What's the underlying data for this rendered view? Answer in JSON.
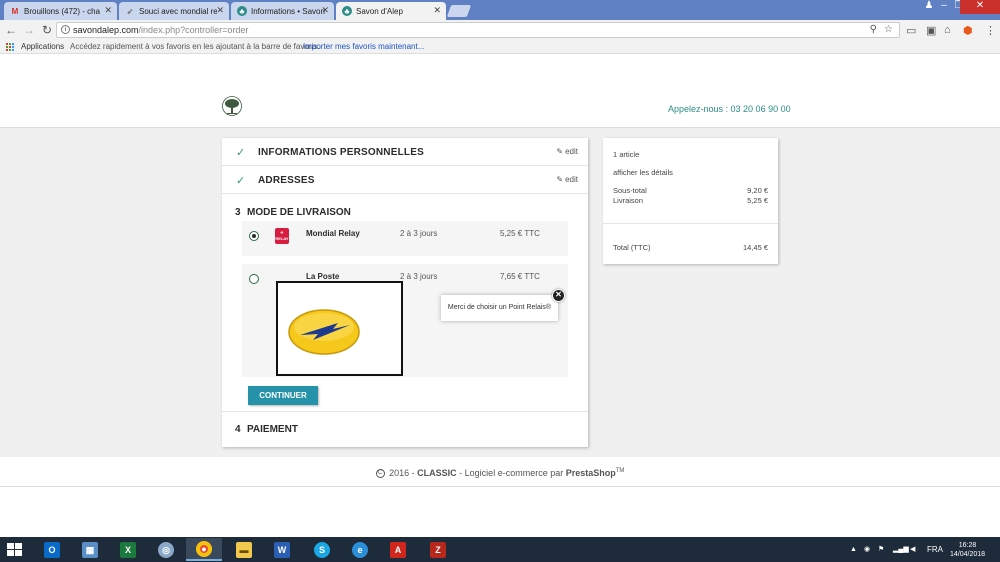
{
  "browser": {
    "tabs": [
      {
        "label": "Brouillons (472) - cha",
        "icon": "gmail-icon",
        "active": false
      },
      {
        "label": "Souci avec mondial re",
        "icon": "bird-icon",
        "active": false
      },
      {
        "label": "Informations • Savon",
        "icon": "tree-icon",
        "active": false
      },
      {
        "label": "Savon d'Alep",
        "icon": "tree-icon",
        "active": true
      }
    ],
    "url_host": "savondalep.com",
    "url_path": "/index.php?controller=order",
    "bookmarks": {
      "apps_label": "Applications",
      "hint": "Accédez rapidement à vos favoris en les ajoutant à la barre de favoris.",
      "import_link": "Importer mes favoris maintenant..."
    }
  },
  "header": {
    "phone": "Appelez-nous : 03 20 06 90 00"
  },
  "checkout": {
    "steps_done": [
      {
        "title": "INFORMATIONS PERSONNELLES",
        "edit": "edit"
      },
      {
        "title": "ADRESSES",
        "edit": "edit"
      }
    ],
    "delivery": {
      "number": "3",
      "title": "MODE DE LIVRAISON",
      "carriers": [
        {
          "name": "Mondial Relay",
          "delay": "2 à 3 jours",
          "price": "5,25 € TTC",
          "selected": true,
          "logo_text": "RELAY"
        },
        {
          "name": "La Poste",
          "delay": "2 à 3 jours",
          "price": "7,65 € TTC",
          "selected": false
        }
      ],
      "tooltip": "Merci de choisir un Point Relais®",
      "continue_label": "CONTINUER"
    },
    "payment": {
      "number": "4",
      "title": "PAIEMENT"
    }
  },
  "summary": {
    "count": "1 article",
    "details_link": "afficher les détails",
    "subtotal_label": "Sous-total",
    "subtotal_value": "9,20 €",
    "shipping_label": "Livraison",
    "shipping_value": "5,25 €",
    "total_label": "Total (TTC)",
    "total_value": "14,45 €"
  },
  "footer": {
    "year_text": "2016 -",
    "brand": "CLASSIC",
    "text": "- Logiciel e-commerce par",
    "vendor": "PrestaShop",
    "tm": "TM"
  },
  "taskbar": {
    "lang": "FRA",
    "time": "16:28",
    "date": "14/04/2018"
  },
  "colors": {
    "accent": "#2592a9",
    "phone": "#2c8d88",
    "check": "#3a9a5d",
    "relay": "#d81c3f"
  }
}
